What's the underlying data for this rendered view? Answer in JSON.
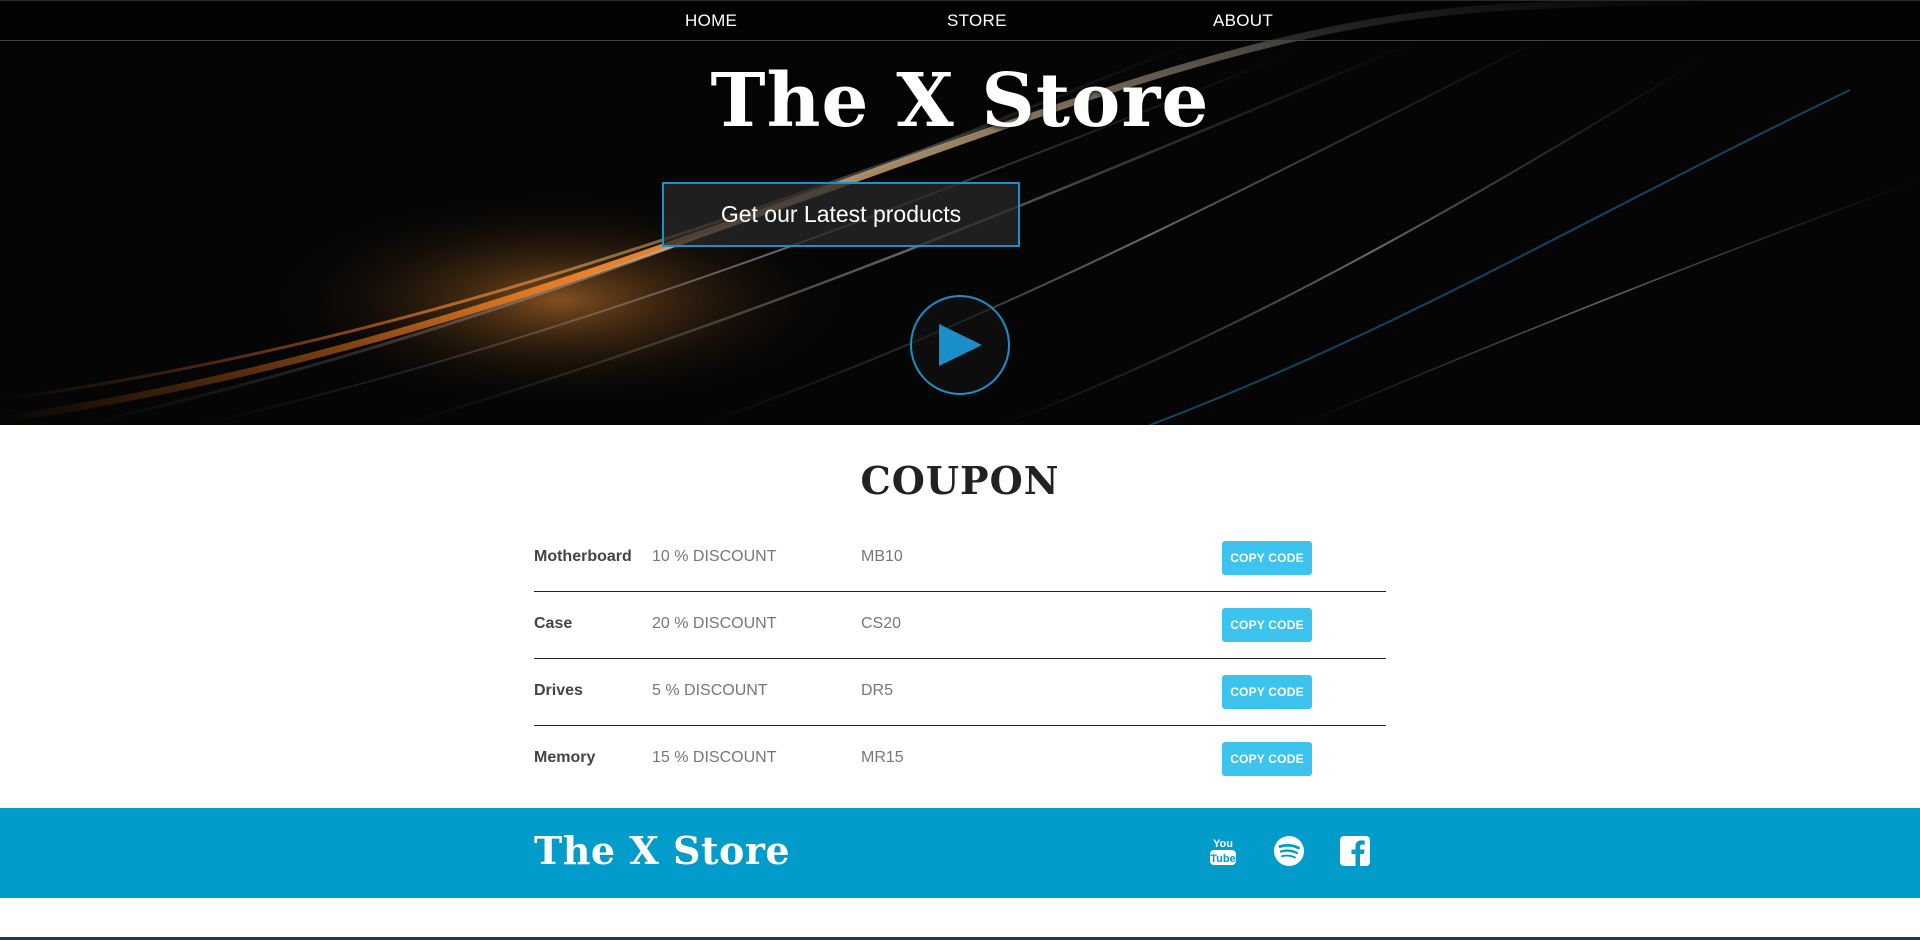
{
  "nav": {
    "items": [
      {
        "label": "HOME"
      },
      {
        "label": "STORE"
      },
      {
        "label": "ABOUT"
      }
    ]
  },
  "hero": {
    "title": "The X Store",
    "cta_label": "Get our Latest products"
  },
  "coupon": {
    "heading": "COUPON",
    "rows": [
      {
        "product": "Motherboard",
        "discount": "10 % DISCOUNT",
        "code": "MB10",
        "button": "COPY CODE"
      },
      {
        "product": "Case",
        "discount": "20 % DISCOUNT",
        "code": "CS20",
        "button": "COPY CODE"
      },
      {
        "product": "Drives",
        "discount": "5 % DISCOUNT",
        "code": "DR5",
        "button": "COPY CODE"
      },
      {
        "product": "Memory",
        "discount": "15 % DISCOUNT",
        "code": "MR15",
        "button": "COPY CODE"
      }
    ]
  },
  "footer": {
    "logo": "The X Store",
    "social_icons": [
      "youtube-icon",
      "spotify-icon",
      "facebook-icon"
    ]
  },
  "colors": {
    "accent": "#3cc4ef",
    "footer_bg": "#029ccb",
    "play_blue": "#1a8fc9"
  }
}
